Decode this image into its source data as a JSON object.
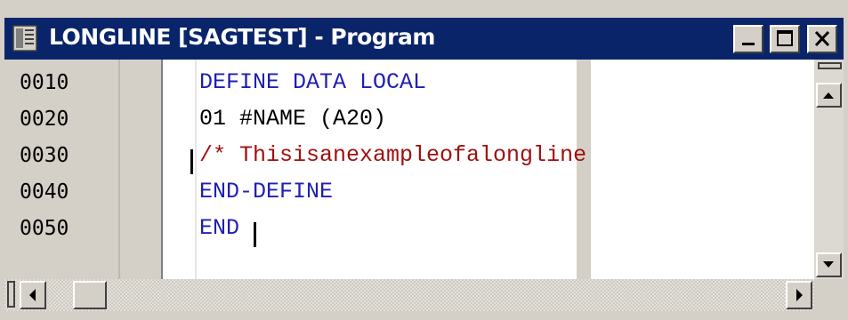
{
  "window": {
    "title": "LONGLINE [SAGTEST] - Program",
    "icon": "program-editor-icon",
    "buttons": {
      "minimize": "minimize-icon",
      "maximize": "maximize-icon",
      "close": "close-icon"
    }
  },
  "editor": {
    "lines": [
      {
        "number": "0010",
        "text": "DEFINE DATA LOCAL"
      },
      {
        "number": "0020",
        "text": "01 #NAME (A20)"
      },
      {
        "number": "0030",
        "text": "/* Thisisanexampleofalongline"
      },
      {
        "number": "0040",
        "text": "END-DEFINE"
      },
      {
        "number": "0050",
        "text": "END"
      }
    ]
  },
  "colors": {
    "titlebar": "#0a246a",
    "keyword": "#1f1fb4",
    "comment": "#a01010",
    "chrome": "#d4d0c8"
  }
}
